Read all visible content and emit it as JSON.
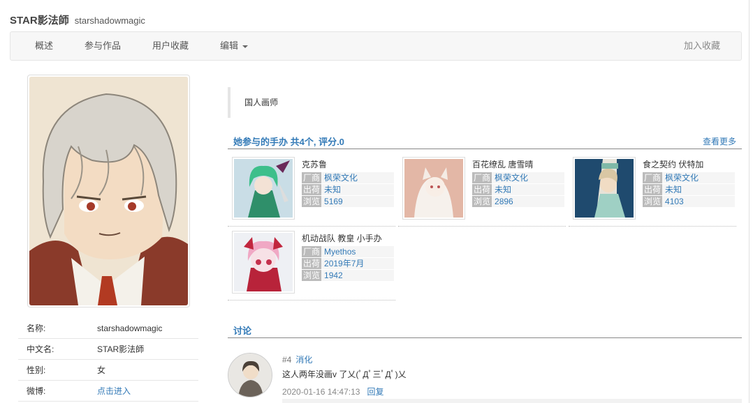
{
  "header": {
    "title": "STAR影法師",
    "subtitle": "starshadowmagic"
  },
  "nav": {
    "overview": "概述",
    "works": "参与作品",
    "favorites": "用户收藏",
    "edit": "编辑",
    "add_fav": "加入收藏"
  },
  "profile": {
    "rows": [
      {
        "label": "名称:",
        "value": "starshadowmagic"
      },
      {
        "label": "中文名:",
        "value": "STAR影法師"
      },
      {
        "label": "性别:",
        "value": "女"
      },
      {
        "label": "微博:",
        "value": "点击进入"
      }
    ]
  },
  "intro": "国人画师",
  "figures_section": {
    "title": "她参与的手办 共4个, 评分.0",
    "more": "查看更多"
  },
  "tags": {
    "maker": "厂商",
    "release": "出荷",
    "views": "浏览"
  },
  "figures": [
    {
      "name": "克苏鲁",
      "maker": "枫荣文化",
      "release": "未知",
      "views": "5169"
    },
    {
      "name": "百花缭乱 唐雪晴",
      "maker": "枫荣文化",
      "release": "未知",
      "views": "2896"
    },
    {
      "name": "食之契约 伏特加",
      "maker": "枫荣文化",
      "release": "未知",
      "views": "4103"
    },
    {
      "name": "机动战队 教皇 小手办",
      "maker": "Myethos",
      "release": "2019年7月",
      "views": "1942"
    }
  ],
  "discussion": {
    "title": "讨论",
    "comment": {
      "floor": "#4",
      "user": "消化",
      "text": "这人两年没画v 了乂(ﾟДﾟ三ﾟДﾟ)乂",
      "time": "2020-01-16 14:47:13",
      "reply": "回复"
    }
  },
  "colors": {
    "link": "#337ab7",
    "tag_bg": "#bbbbbb",
    "nav_bg": "#f7f7f7"
  },
  "icons": {
    "edit_dropdown": "chevron-down-icon"
  }
}
